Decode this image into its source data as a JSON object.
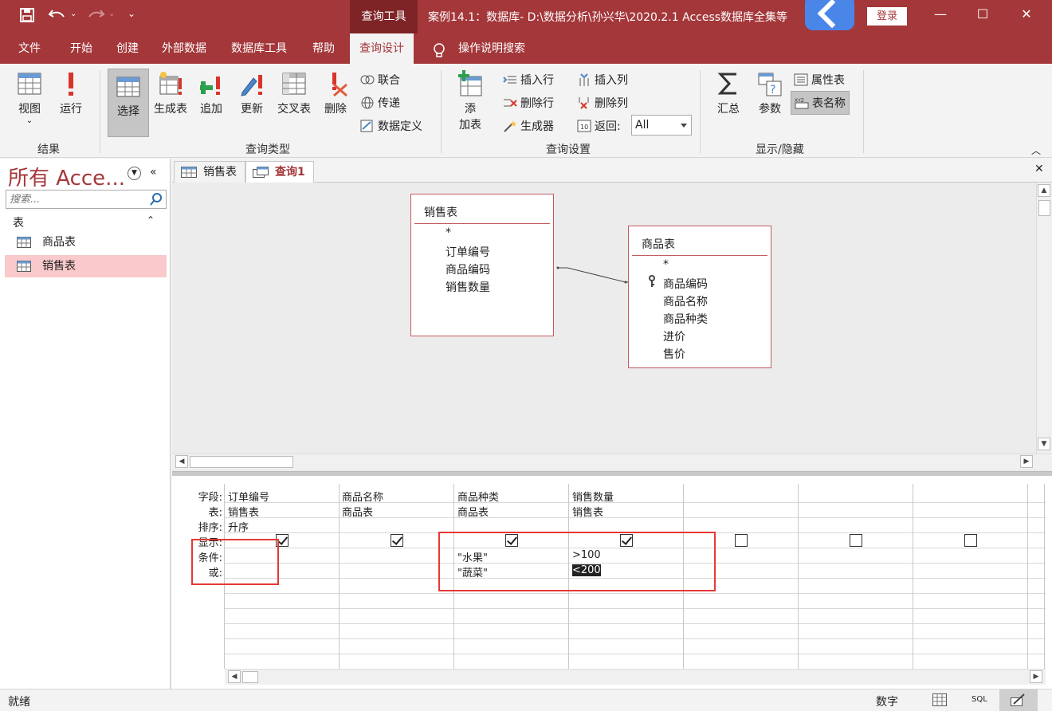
{
  "titlebar": {
    "context_tab": "查询工具",
    "doc_title": "案例14.1：数据库- D:\\数据分析\\孙兴华\\2020.2.1 Access数据库全集等",
    "login": "登录",
    "save_icon": "save-icon",
    "undo_icon": "undo-icon",
    "redo_icon": "redo-icon",
    "minimize_glyph": "—",
    "maximize_glyph": "☐",
    "close_glyph": "✕"
  },
  "tabs": {
    "file": "文件",
    "home": "开始",
    "create": "创建",
    "external": "外部数据",
    "dbtools": "数据库工具",
    "help": "帮助",
    "query_design": "查询设计",
    "tell_me": "操作说明搜索"
  },
  "ribbon": {
    "results": {
      "view": "视图",
      "run": "运行",
      "label": "结果"
    },
    "query_type": {
      "select": "选择",
      "make_table": "生成表",
      "append": "追加",
      "update": "更新",
      "crosstab": "交叉表",
      "delete": "删除",
      "union": "联合",
      "passthrough": "传递",
      "data_def": "数据定义",
      "label": "查询类型"
    },
    "query_setup": {
      "add_table_1": "添",
      "add_table_2": "加表",
      "insert_row": "插入行",
      "delete_row": "删除行",
      "builder": "生成器",
      "insert_col": "插入列",
      "delete_col": "删除列",
      "return_label": "返回:",
      "return_value": "All",
      "label": "查询设置"
    },
    "show_hide": {
      "totals": "汇总",
      "params": "参数",
      "property_sheet": "属性表",
      "table_names": "表名称",
      "label": "显示/隐藏"
    }
  },
  "nav": {
    "title": "所有 Acce...",
    "search_placeholder": "搜索...",
    "section": "表",
    "items": [
      "商品表",
      "销售表"
    ]
  },
  "doc_tabs": [
    "销售表",
    "查询1"
  ],
  "design": {
    "tables": [
      {
        "name": "销售表",
        "fields": [
          "*",
          "订单编号",
          "商品编码",
          "销售数量"
        ]
      },
      {
        "name": "商品表",
        "fields": [
          "*",
          "商品编码",
          "商品名称",
          "商品种类",
          "进价",
          "售价"
        ]
      }
    ]
  },
  "grid": {
    "row_labels": [
      "字段:",
      "表:",
      "排序:",
      "显示:",
      "条件:",
      "或:"
    ],
    "columns": [
      {
        "field": "订单编号",
        "table": "销售表",
        "sort": "升序",
        "show": true,
        "criteria": "",
        "or": ""
      },
      {
        "field": "商品名称",
        "table": "商品表",
        "sort": "",
        "show": true,
        "criteria": "",
        "or": ""
      },
      {
        "field": "商品种类",
        "table": "商品表",
        "sort": "",
        "show": true,
        "criteria": "\"水果\"",
        "or": "\"蔬菜\""
      },
      {
        "field": "销售数量",
        "table": "销售表",
        "sort": "",
        "show": true,
        "criteria": ">100",
        "or": "<200"
      },
      {
        "field": "",
        "table": "",
        "sort": "",
        "show": false,
        "criteria": "",
        "or": ""
      },
      {
        "field": "",
        "table": "",
        "sort": "",
        "show": false,
        "criteria": "",
        "or": ""
      },
      {
        "field": "",
        "table": "",
        "sort": "",
        "show": false,
        "criteria": "",
        "or": ""
      }
    ]
  },
  "status": {
    "left": "就绪",
    "mode": "数字",
    "sql": "SQL"
  },
  "colors": {
    "accent": "#a4373a",
    "highlight_box": "#e53935",
    "nav_selected": "#f9c9cb"
  }
}
